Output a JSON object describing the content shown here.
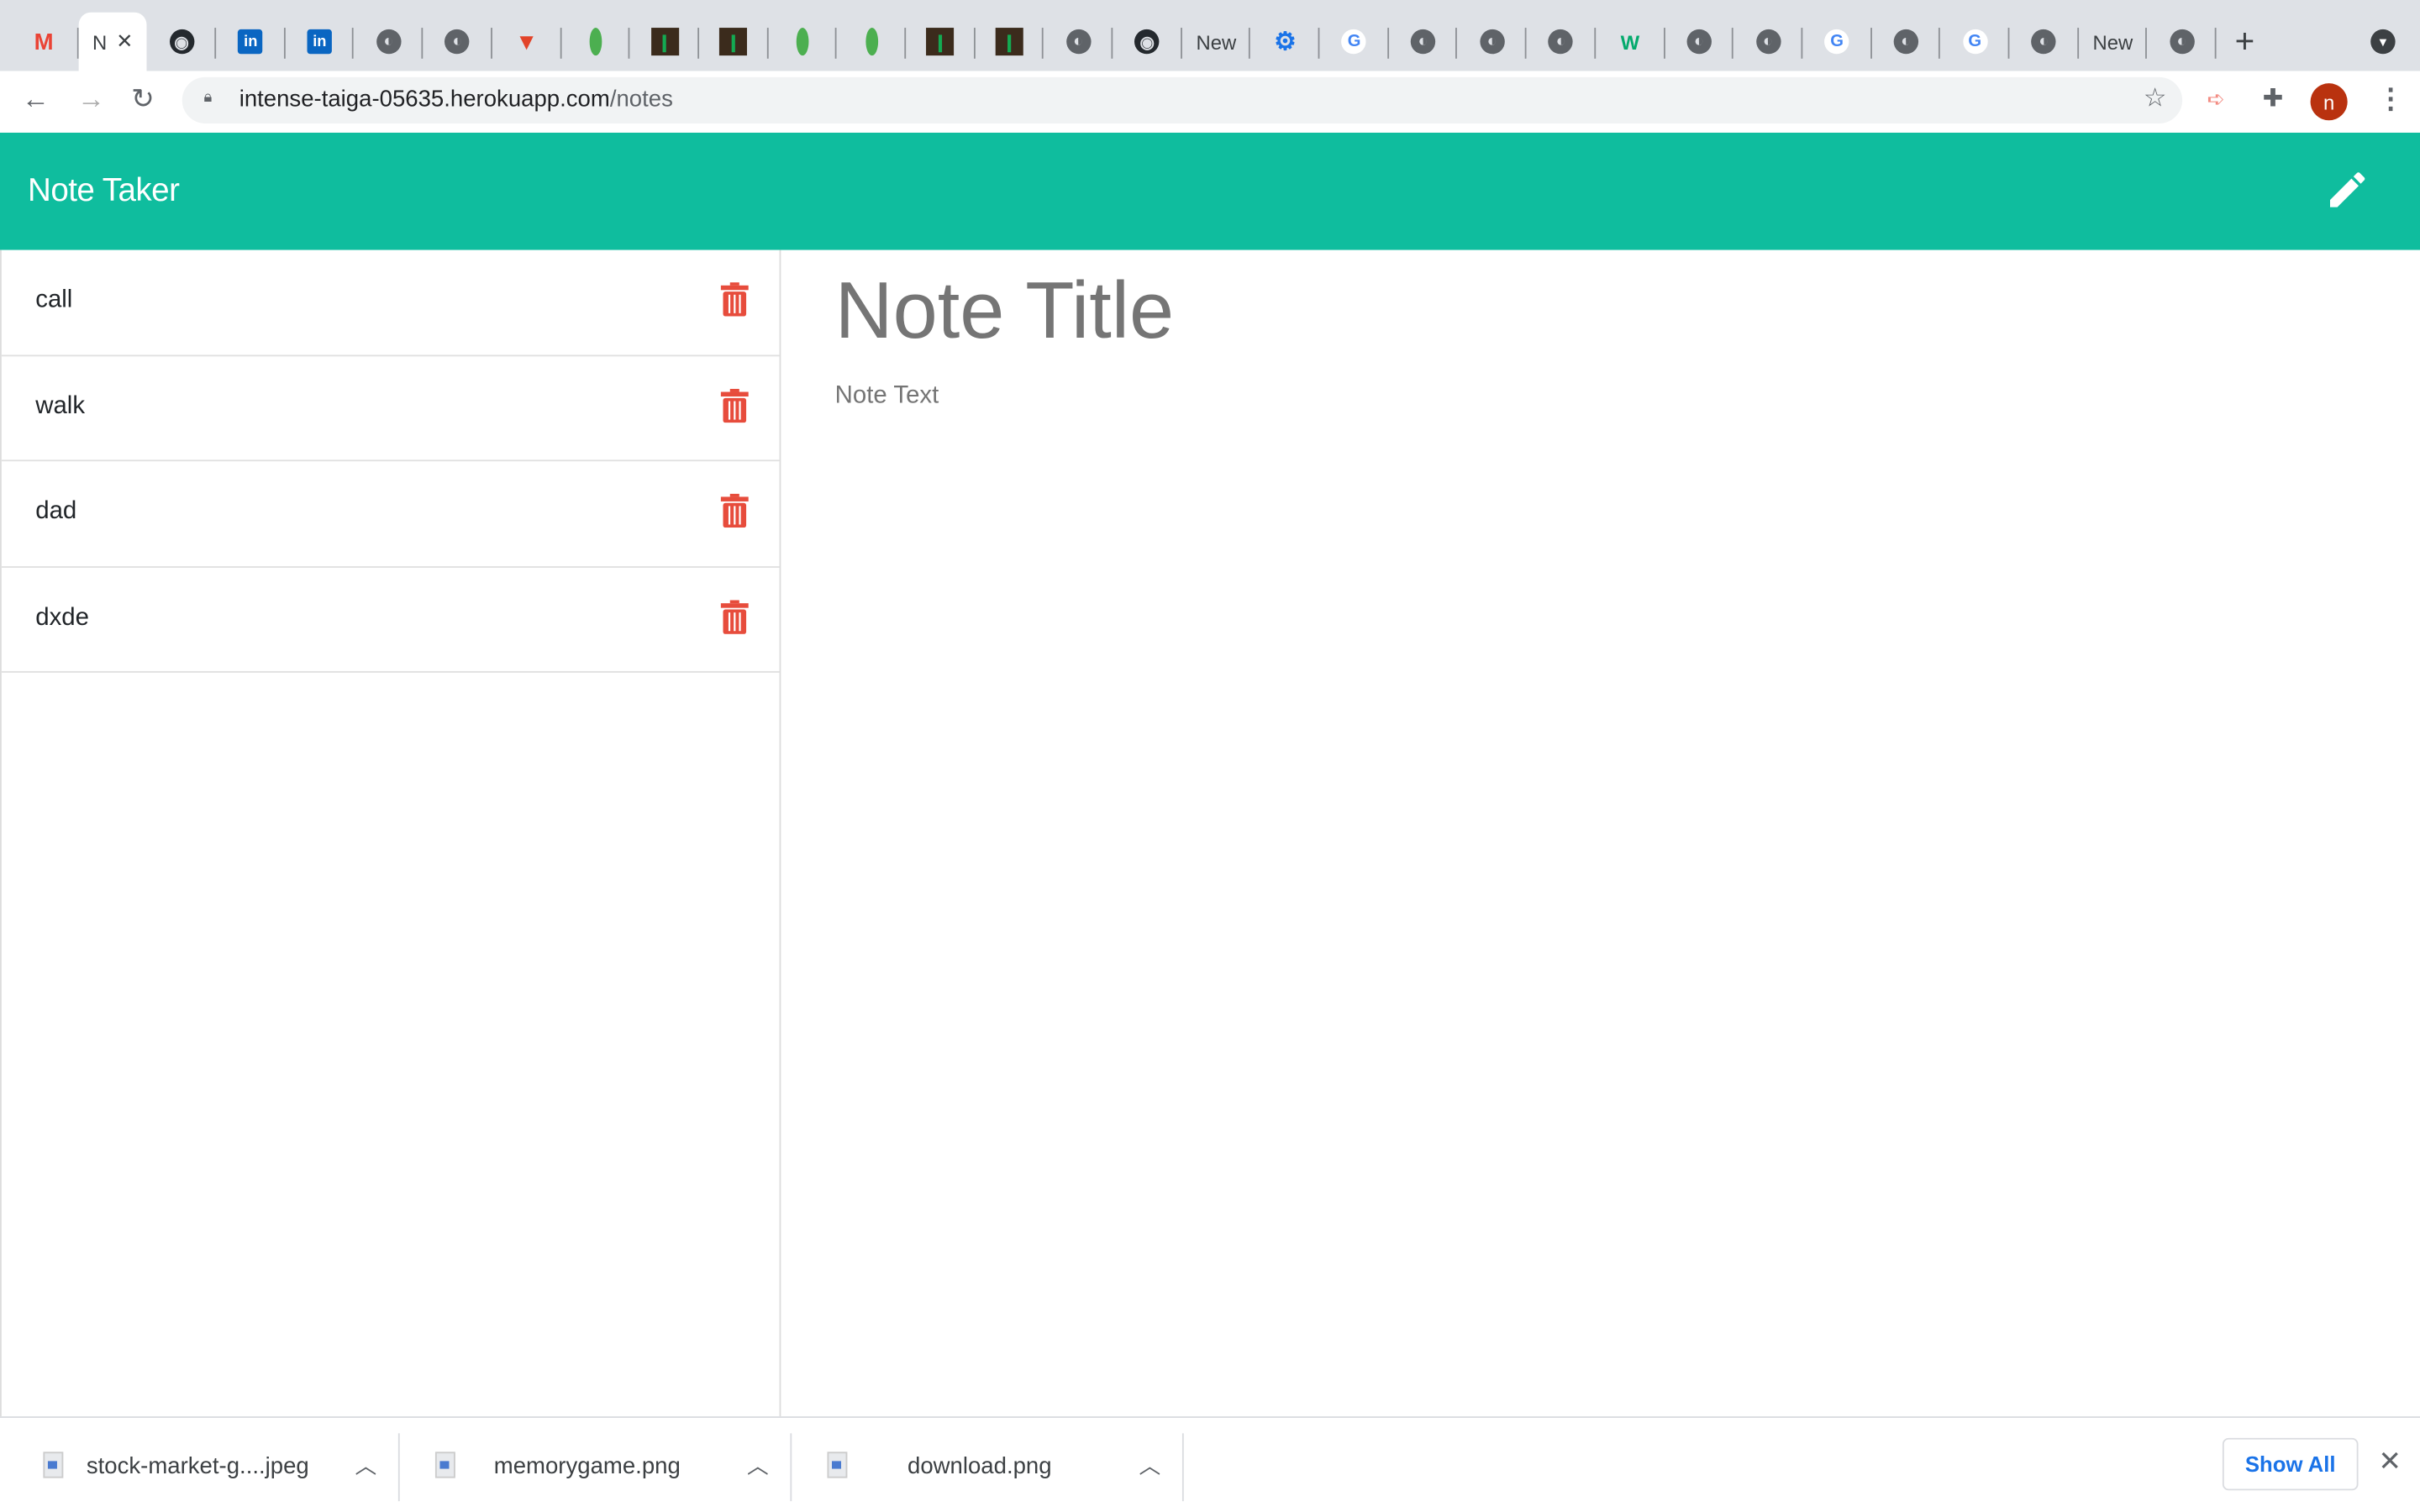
{
  "browser": {
    "tabs": [
      {
        "icon": "gmail",
        "label": ""
      },
      {
        "icon": "",
        "label": "N",
        "active": true
      },
      {
        "icon": "github",
        "label": ""
      },
      {
        "icon": "linkedin",
        "label": ""
      },
      {
        "icon": "linkedin",
        "label": ""
      },
      {
        "icon": "globe",
        "label": ""
      },
      {
        "icon": "globe",
        "label": ""
      },
      {
        "icon": "gitlab",
        "label": ""
      },
      {
        "icon": "leaf",
        "label": ""
      },
      {
        "icon": "mongo-dark",
        "label": ""
      },
      {
        "icon": "mongo-dark",
        "label": ""
      },
      {
        "icon": "leaf",
        "label": ""
      },
      {
        "icon": "leaf",
        "label": ""
      },
      {
        "icon": "mongo-dark",
        "label": ""
      },
      {
        "icon": "mongo-dark",
        "label": ""
      },
      {
        "icon": "globe",
        "label": ""
      },
      {
        "icon": "github",
        "label": ""
      },
      {
        "icon": "",
        "label": "New"
      },
      {
        "icon": "gear",
        "label": ""
      },
      {
        "icon": "google",
        "label": ""
      },
      {
        "icon": "globe",
        "label": ""
      },
      {
        "icon": "globe",
        "label": ""
      },
      {
        "icon": "globe",
        "label": ""
      },
      {
        "icon": "w3",
        "label": ""
      },
      {
        "icon": "globe",
        "label": ""
      },
      {
        "icon": "globe",
        "label": ""
      },
      {
        "icon": "google",
        "label": ""
      },
      {
        "icon": "globe",
        "label": ""
      },
      {
        "icon": "google",
        "label": ""
      },
      {
        "icon": "globe",
        "label": ""
      },
      {
        "icon": "",
        "label": "New"
      },
      {
        "icon": "globe",
        "label": ""
      }
    ],
    "url_host": "intense-taiga-05635.herokuapp.com",
    "url_path": "/notes",
    "profile_initial": "n"
  },
  "app": {
    "title": "Note Taker",
    "accent": "#0fbd9e",
    "delete_color": "#e74c3c",
    "notes": [
      {
        "title": "call"
      },
      {
        "title": "walk"
      },
      {
        "title": "dad"
      },
      {
        "title": "dxde"
      }
    ],
    "editor": {
      "title_placeholder": "Note Title",
      "text_placeholder": "Note Text"
    }
  },
  "downloads": {
    "items": [
      {
        "name": "stock-market-g....jpeg"
      },
      {
        "name": "memorygame.png"
      },
      {
        "name": "download.png"
      }
    ],
    "show_all": "Show All"
  }
}
